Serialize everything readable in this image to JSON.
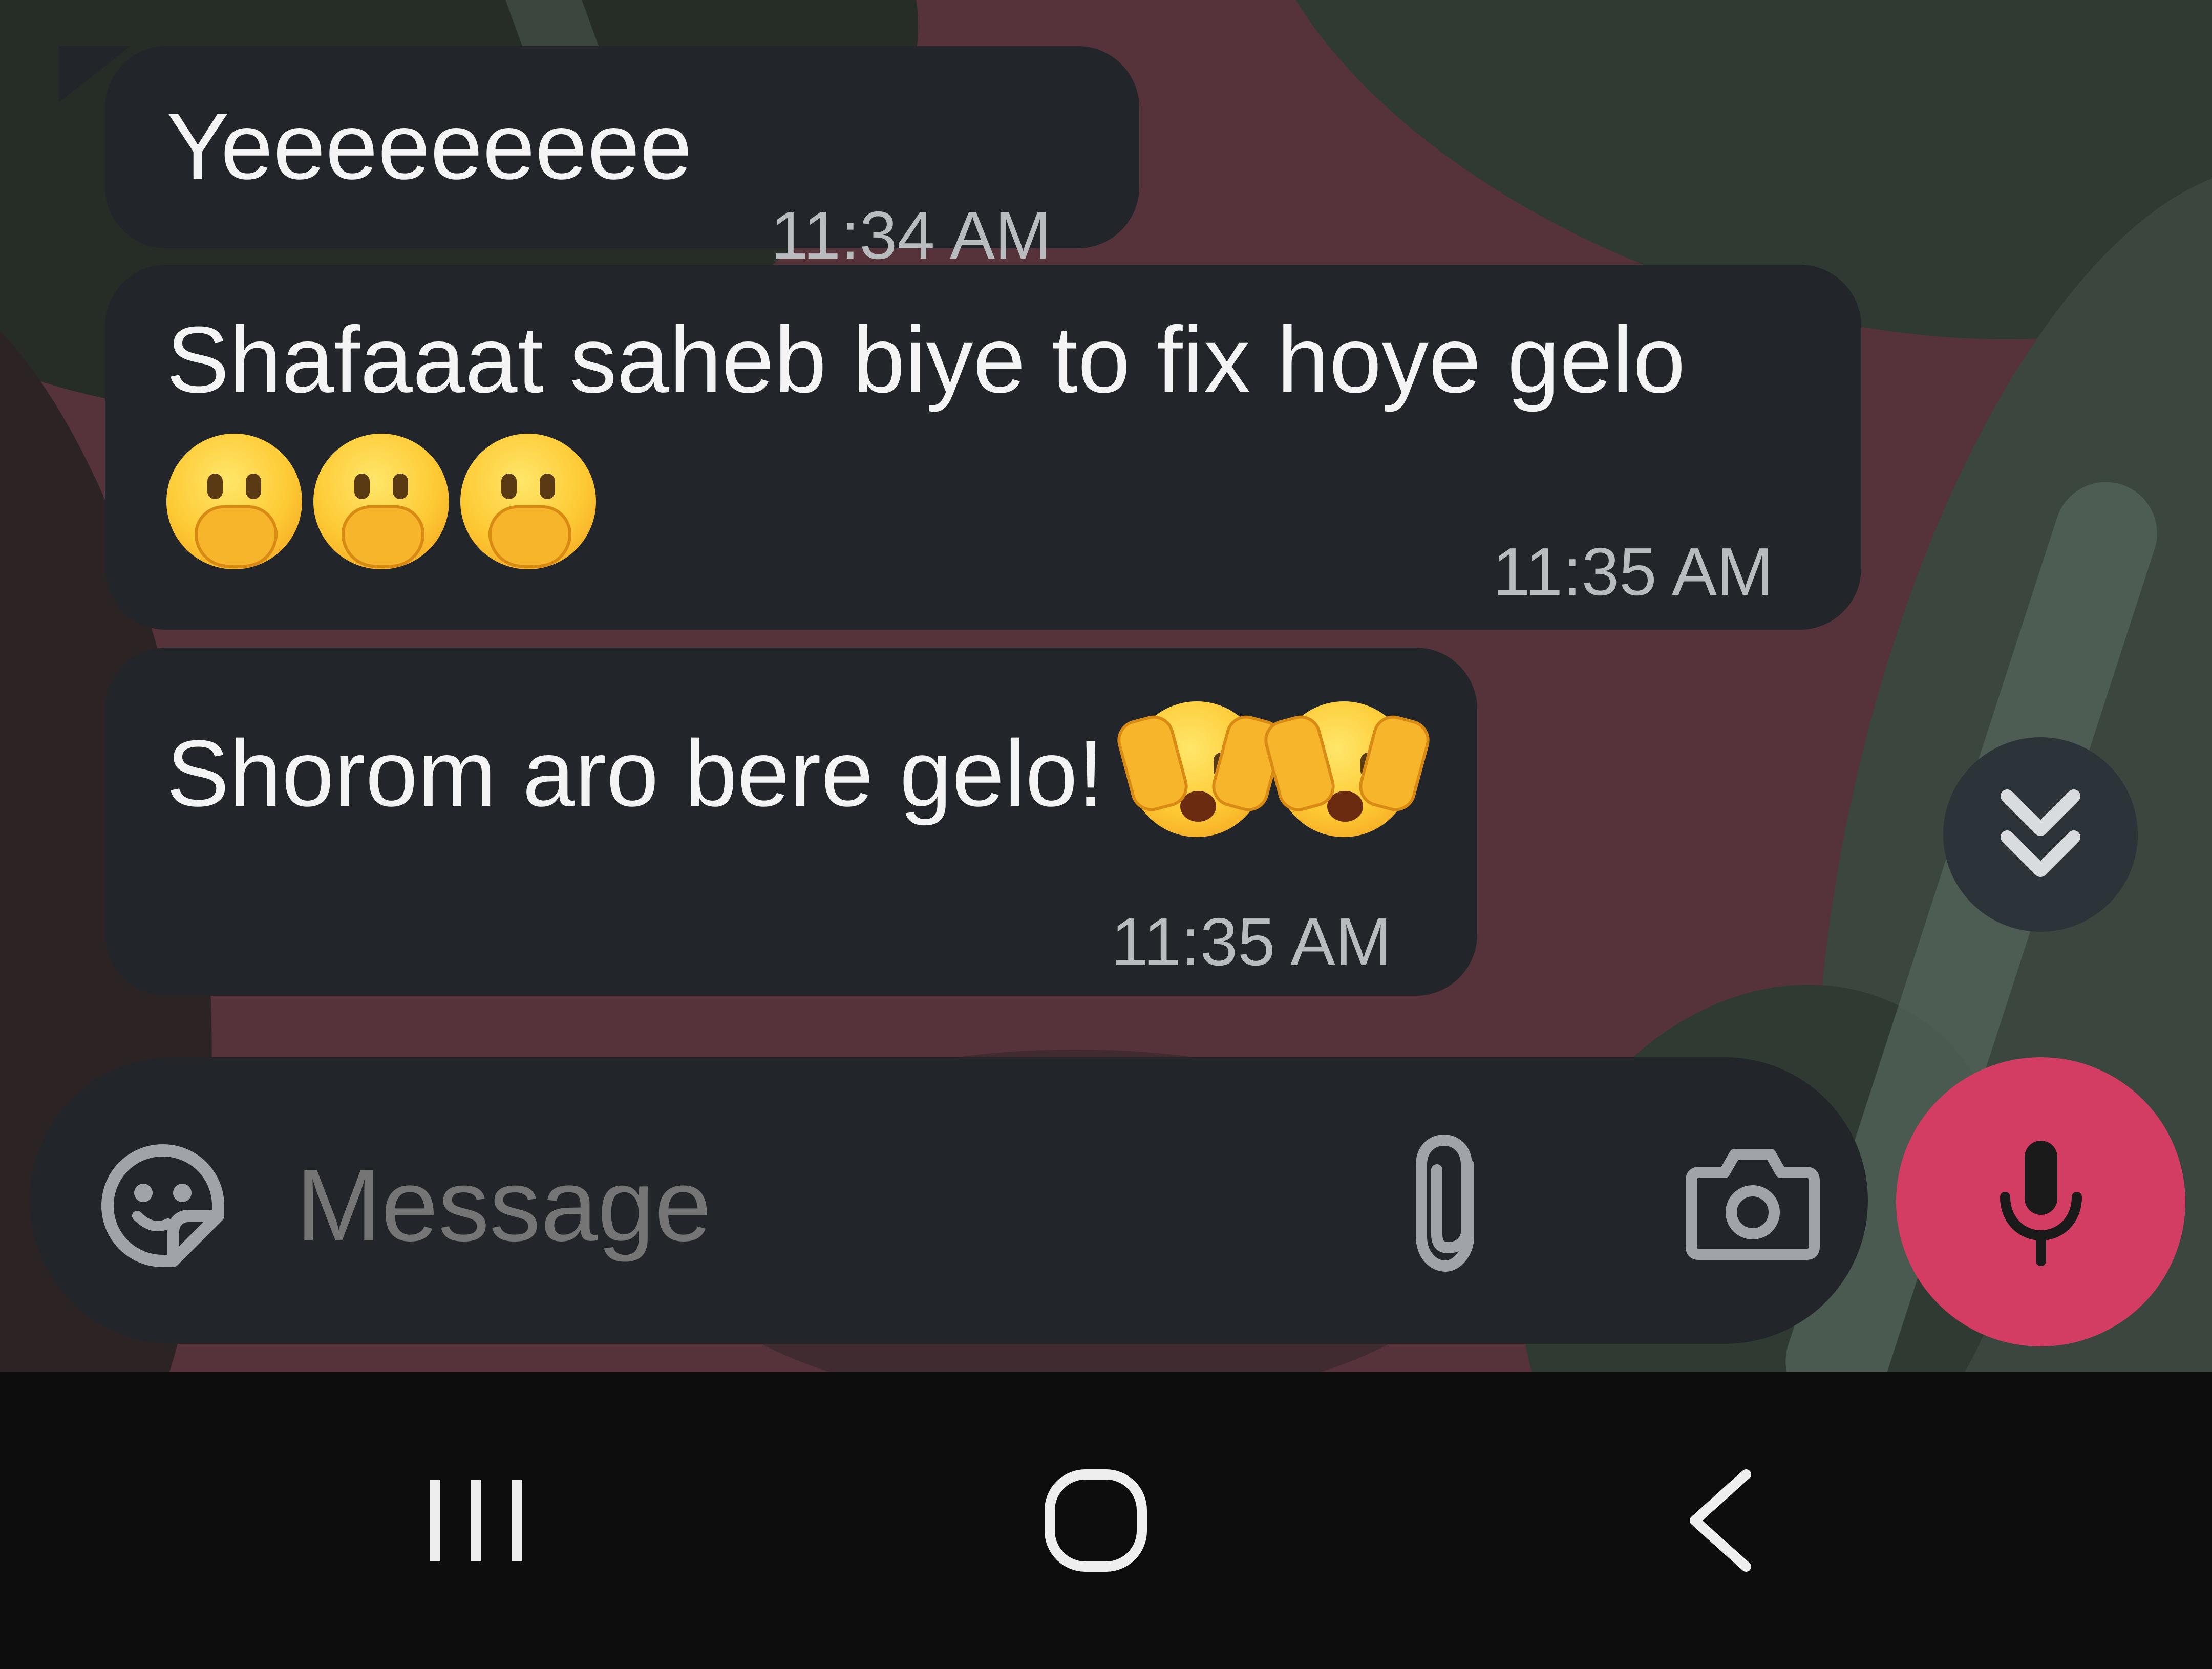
{
  "messages": [
    {
      "text": "Yeeeeeeeee",
      "time": "11:34 AM"
    },
    {
      "text": "Shafaaat saheb biye to fix hoye gelo",
      "emojis": [
        "face-with-hand-over-mouth",
        "face-with-hand-over-mouth",
        "face-with-hand-over-mouth"
      ],
      "time": "11:35 AM"
    },
    {
      "text": "Shorom aro bere gelo!",
      "emojis": [
        "face-with-hands-over-face",
        "face-with-hands-over-face"
      ],
      "time": "11:35 AM"
    }
  ],
  "composer": {
    "placeholder": "Message",
    "icons": [
      "sticker-icon",
      "attach-icon",
      "camera-icon",
      "mic-icon"
    ]
  },
  "scroll_button": {
    "icon": "double-chevron-down-icon"
  },
  "nav_bar": {
    "icons": [
      "recents-icon",
      "home-icon",
      "back-icon"
    ]
  },
  "colors": {
    "bubble": "#22262b",
    "accent_mic": "#d43d63",
    "timestamp": "#b9bcbf",
    "placeholder": "#9ea2a6"
  }
}
